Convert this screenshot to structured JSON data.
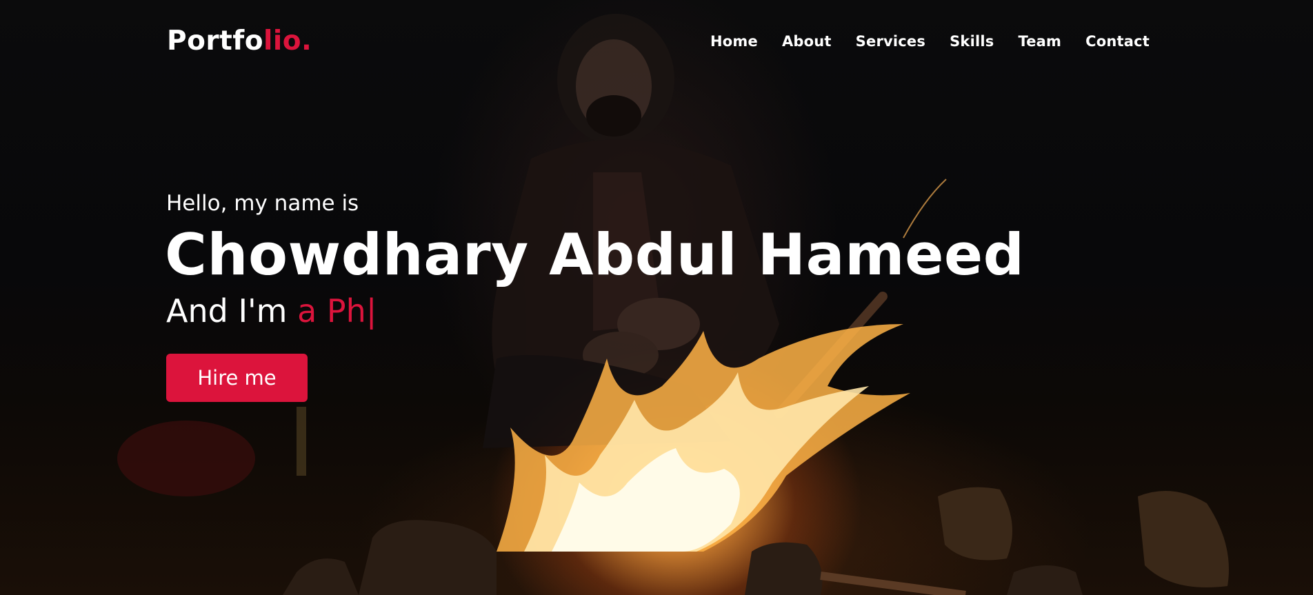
{
  "navbar": {
    "logo_main": "Portfo",
    "logo_accent": "lio.",
    "menu": [
      {
        "label": "Home"
      },
      {
        "label": "About"
      },
      {
        "label": "Services"
      },
      {
        "label": "Skills"
      },
      {
        "label": "Team"
      },
      {
        "label": "Contact"
      }
    ]
  },
  "hero": {
    "greeting": "Hello, my name is",
    "name": "Chowdhary Abdul Hameed",
    "tagline_prefix": "And I'm ",
    "tagline_typed": "a Ph",
    "cursor": "|",
    "hire_button": "Hire me"
  },
  "colors": {
    "accent": "#dc143c",
    "text": "#ffffff",
    "background": "#050505"
  }
}
